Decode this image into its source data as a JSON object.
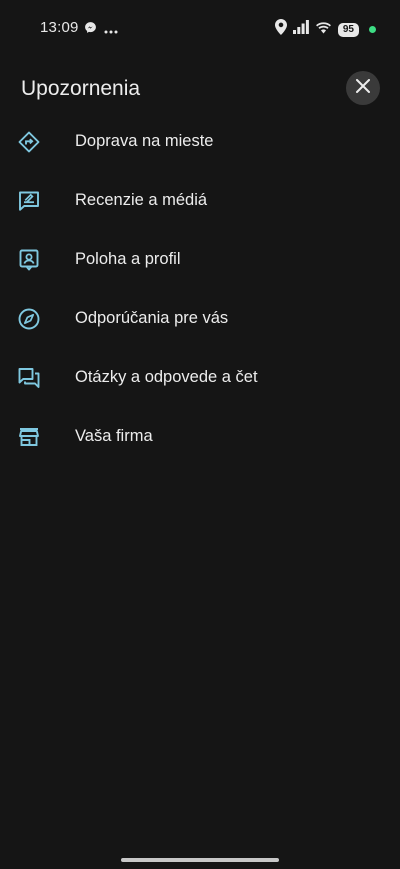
{
  "status_bar": {
    "time": "13:09",
    "battery": "95",
    "left_icons": [
      "messenger-icon",
      "more-dots-icon"
    ],
    "right_icons": [
      "location-icon",
      "signal-icon",
      "wifi-icon"
    ],
    "indicator_color": "#3ddc84"
  },
  "header": {
    "title": "Upozornenia",
    "close_icon": "close-icon"
  },
  "menu": {
    "items": [
      {
        "label": "Doprava na mieste",
        "icon": "directions-icon"
      },
      {
        "label": "Recenzie a médiá",
        "icon": "review-icon"
      },
      {
        "label": "Poloha a profil",
        "icon": "profile-location-icon"
      },
      {
        "label": "Odporúčania pre vás",
        "icon": "compass-icon"
      },
      {
        "label": "Otázky a odpovede a čet",
        "icon": "chat-icon"
      },
      {
        "label": "Vaša firma",
        "icon": "store-icon"
      }
    ]
  },
  "colors": {
    "background": "#151515",
    "icon_accent": "#7fc8e0",
    "text": "#ececec"
  }
}
